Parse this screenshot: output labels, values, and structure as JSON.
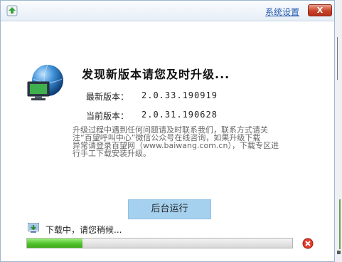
{
  "titlebar": {
    "settings_label": "系统设置",
    "close_label": "X"
  },
  "headline": "发现新版本请您及时升级...",
  "versions": {
    "latest_label": "最新版本：",
    "latest_value": "2.0.33.190919",
    "current_label": "当前版本：",
    "current_value": "2.0.31.190628"
  },
  "notice": {
    "lines": [
      "升级过程中遇到任何问题请及时联系我们，联系方式请关",
      "注“百望呼叫中心”微信公众号在线咨询，如果升级下载",
      "异常请登录百望网（www.baiwang.com.cn），下载专区进",
      "行手工下载安装升级。"
    ]
  },
  "background_button_label": "后台运行",
  "download": {
    "status": "下载中，请您稍候...",
    "progress": 0.21
  },
  "icons": {
    "app": "upgrade-arrow-icon",
    "globe": "globe-monitor-icon",
    "download": "download-icon",
    "cancel": "cancel-icon"
  },
  "colors": {
    "close_button": "#c9422a",
    "background_button": "#a5d1ef",
    "progress_fill": "#52c22d",
    "link": "#2a5db0"
  }
}
